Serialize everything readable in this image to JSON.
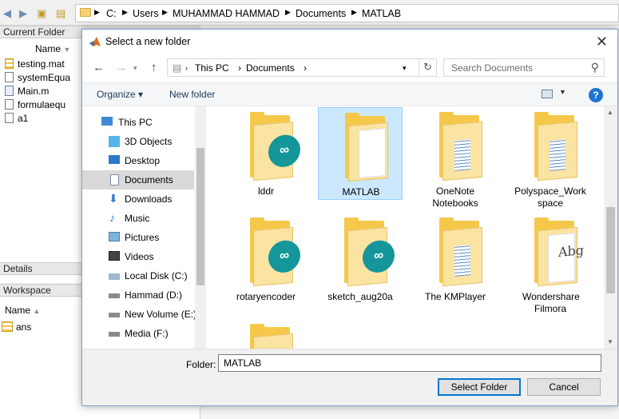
{
  "matlab": {
    "path": [
      "C:",
      "Users",
      "MUHAMMAD HAMMAD",
      "Documents",
      "MATLAB"
    ],
    "current_folder": {
      "title": "Current Folder",
      "column": "Name",
      "files": [
        "testing.mat",
        "systemEqua",
        "Main.m",
        "formulaequ",
        "a1"
      ]
    },
    "details": {
      "title": "Details"
    },
    "workspace": {
      "title": "Workspace",
      "column": "Name",
      "items": [
        "ans"
      ]
    }
  },
  "dialog": {
    "title": "Select a new folder",
    "close_glyph": "✕",
    "address": [
      "This PC",
      "Documents"
    ],
    "search_placeholder": "Search Documents",
    "toolbar": {
      "organize": "Organize ▾",
      "new_folder": "New folder",
      "help": "?"
    },
    "nav_items": [
      {
        "label": "This PC",
        "icon": "computer-icon"
      },
      {
        "label": "3D Objects",
        "icon": "cube-icon"
      },
      {
        "label": "Desktop",
        "icon": "desktop-icon"
      },
      {
        "label": "Documents",
        "icon": "document-icon",
        "selected": true
      },
      {
        "label": "Downloads",
        "icon": "download-arrow-icon"
      },
      {
        "label": "Music",
        "icon": "music-note-icon"
      },
      {
        "label": "Pictures",
        "icon": "pictures-icon"
      },
      {
        "label": "Videos",
        "icon": "film-icon"
      },
      {
        "label": "Local Disk (C:)",
        "icon": "drive-icon"
      },
      {
        "label": "Hammad (D:)",
        "icon": "drive-icon"
      },
      {
        "label": "New Volume (E:)",
        "icon": "drive-icon"
      },
      {
        "label": "Media (F:)",
        "icon": "drive-icon"
      }
    ],
    "folders": [
      {
        "name": "lddr",
        "overlay": "arduino"
      },
      {
        "name": "MATLAB",
        "overlay": "plain",
        "selected": true
      },
      {
        "name": "OneNote Notebooks",
        "overlay": "lines"
      },
      {
        "name": "Polyspace_Workspace",
        "overlay": "lines"
      },
      {
        "name": "rotaryencoder",
        "overlay": "arduino"
      },
      {
        "name": "sketch_aug20a",
        "overlay": "arduino"
      },
      {
        "name": "The KMPlayer",
        "overlay": "lines"
      },
      {
        "name": "Wondershare Filmora",
        "overlay": "abg"
      }
    ],
    "folder_label": "Folder:",
    "folder_value": "MATLAB",
    "buttons": {
      "select": "Select Folder",
      "cancel": "Cancel"
    }
  }
}
